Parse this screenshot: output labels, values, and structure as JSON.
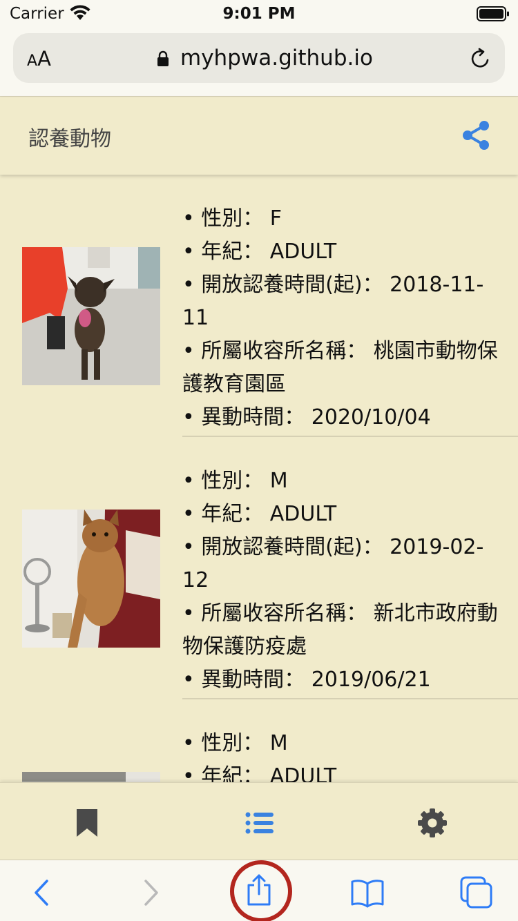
{
  "status_bar": {
    "carrier": "Carrier",
    "time": "9:01 PM"
  },
  "browser": {
    "reader_small": "A",
    "reader_large": "A",
    "url": "myhpwa.github.io"
  },
  "app": {
    "title": "認養動物"
  },
  "animals": [
    {
      "sex": "• 性別： F",
      "age": "• 年紀： ADULT",
      "open_date": "• 開放認養時間(起)： 2018-11-11",
      "shelter": "• 所屬收容所名稱： 桃園市動物保護教育園區",
      "update": "• 異動時間： 2020/10/04"
    },
    {
      "sex": "• 性別： M",
      "age": "• 年紀： ADULT",
      "open_date": "• 開放認養時間(起)： 2019-02-12",
      "shelter": "• 所屬收容所名稱： 新北市政府動物保護防疫處",
      "update": "• 異動時間： 2019/06/21"
    },
    {
      "sex": "• 性別： M",
      "age": "• 年紀： ADULT",
      "open_date": "",
      "shelter": "",
      "update": ""
    }
  ],
  "icons": {
    "share": "share-icon",
    "bookmark": "bookmark-icon",
    "list": "list-icon",
    "settings": "gear-icon",
    "back": "chevron-left-icon",
    "forward": "chevron-right-icon",
    "safari_share": "share-icon",
    "safari_bookmarks": "book-icon",
    "tabs": "tabs-icon"
  },
  "colors": {
    "accent": "#3a82e0",
    "background": "#f1ebcb",
    "highlight": "#b3261e"
  }
}
